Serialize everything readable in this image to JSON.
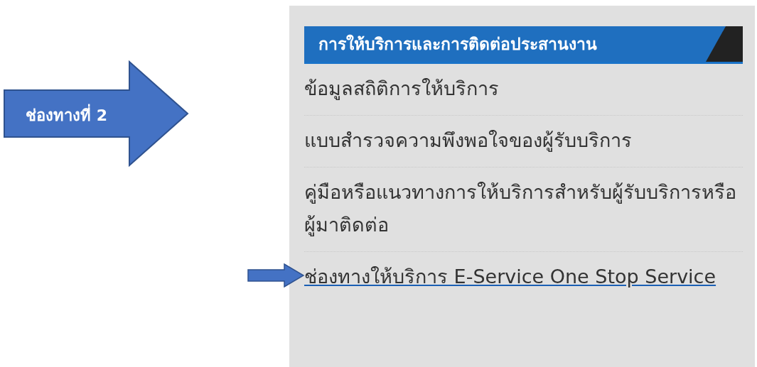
{
  "callout": {
    "label": "ช่องทางที่ 2"
  },
  "panel": {
    "heading": "การให้บริการและการติดต่อประสานงาน",
    "items": [
      {
        "kind": "text",
        "text": "ข้อมูลสถิติการให้บริการ"
      },
      {
        "kind": "text",
        "text": "แบบสำรวจความพึงพอใจของผู้รับบริการ"
      },
      {
        "kind": "text",
        "text": "คู่มือหรือแนวทางการให้บริการสำหรับผู้รับบริการหรือผู้มาติดต่อ"
      },
      {
        "kind": "link",
        "text": "ช่องทางให้บริการ E-Service One Stop Service",
        "pointed": true
      }
    ]
  }
}
